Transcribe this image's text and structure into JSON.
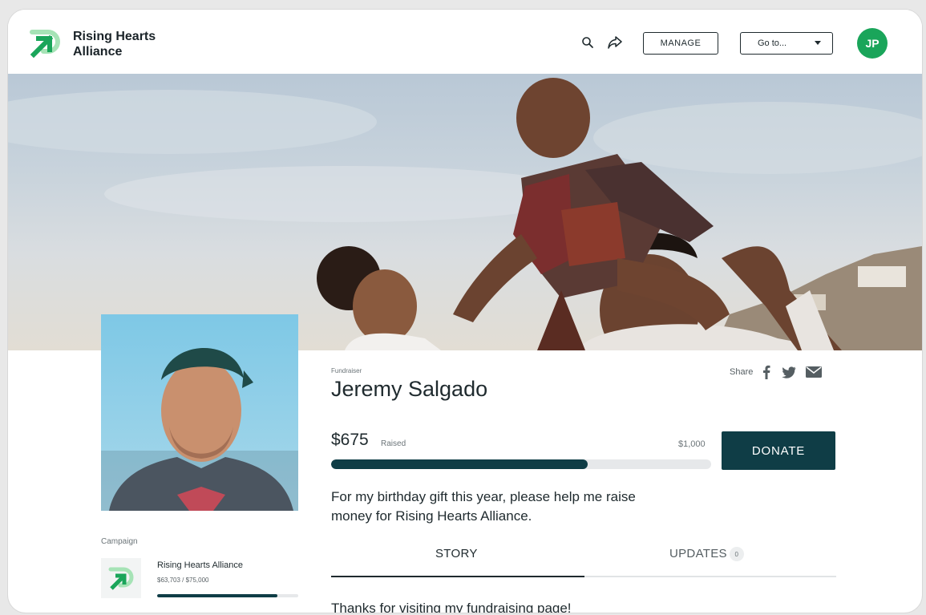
{
  "header": {
    "brand_line1": "Rising Hearts",
    "brand_line2": "Alliance",
    "manage_label": "MANAGE",
    "goto_label": "Go to...",
    "avatar_initials": "JP",
    "icons": [
      "search-icon",
      "share-arrow-icon"
    ]
  },
  "fundraiser": {
    "type_label": "Fundraiser",
    "name": "Jeremy Salgado",
    "share_label": "Share",
    "share_icons": [
      "facebook-icon",
      "twitter-icon",
      "email-icon"
    ],
    "raised_amount": "$675",
    "raised_label": "Raised",
    "goal": "$1,000",
    "progress_fraction": 0.675,
    "donate_label": "DONATE",
    "description_line1": "For my birthday gift this year, please help me raise",
    "description_line2": "money for Rising Hearts Alliance."
  },
  "tabs": {
    "story_label": "STORY",
    "updates_label": "UPDATES",
    "updates_count": "0"
  },
  "story_text": "Thanks for visiting my fundraising page!",
  "campaign": {
    "section_label": "Campaign",
    "name": "Rising Hearts Alliance",
    "amount": "$63,703 / $75,000",
    "progress_fraction": 0.85
  },
  "colors": {
    "brand_green": "#1aa55a",
    "primary_dark": "#0f3d46"
  }
}
